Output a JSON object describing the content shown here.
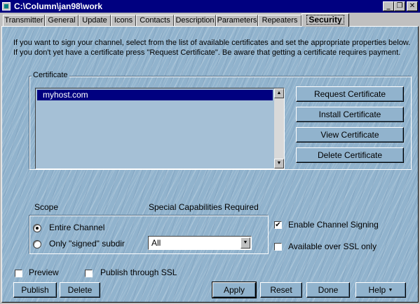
{
  "window": {
    "title": "C:\\Column\\jan98\\work",
    "controls": {
      "minimize": "_",
      "maximize": "❐",
      "close": "✕"
    }
  },
  "tabs": [
    {
      "label": "Transmitter"
    },
    {
      "label": "General"
    },
    {
      "label": "Update"
    },
    {
      "label": "Icons"
    },
    {
      "label": "Contacts"
    },
    {
      "label": "Description"
    },
    {
      "label": "Parameters"
    },
    {
      "label": "Repeaters"
    },
    {
      "label": "Security",
      "active": true
    }
  ],
  "intro_text": "If you want to sign your channel, select from the list of available certificates and set the appropriate properties below. If you don't yet have a certificate press \"Request Certificate\". Be aware that getting a certificate requires payment.",
  "certificate": {
    "label": "Certificate",
    "items": [
      "myhost.com"
    ],
    "selected": "myhost.com",
    "buttons": {
      "request": "Request Certificate",
      "install": "Install Certificate",
      "view": "View Certificate",
      "delete": "Delete Certificate"
    }
  },
  "scope": {
    "label": "Scope",
    "special_label": "Special Capabilities Required",
    "entire_channel": "Entire Channel",
    "only_signed": "Only \"signed\" subdir",
    "selected": "entire_channel",
    "subdir_value": "All"
  },
  "signing": {
    "enable_label": "Enable Channel Signing",
    "enable_checked": true,
    "ssl_label": "Available over SSL only",
    "ssl_checked": false
  },
  "bottom": {
    "preview_label": "Preview",
    "preview_checked": false,
    "publish_ssl_label": "Publish through SSL",
    "publish_ssl_checked": false,
    "publish": "Publish",
    "delete": "Delete",
    "apply": "Apply",
    "reset": "Reset",
    "done": "Done",
    "help": "Help"
  },
  "icons": {
    "check": "✔",
    "scroll_up": "▲",
    "scroll_down": "▼",
    "dropdown": "▼"
  }
}
